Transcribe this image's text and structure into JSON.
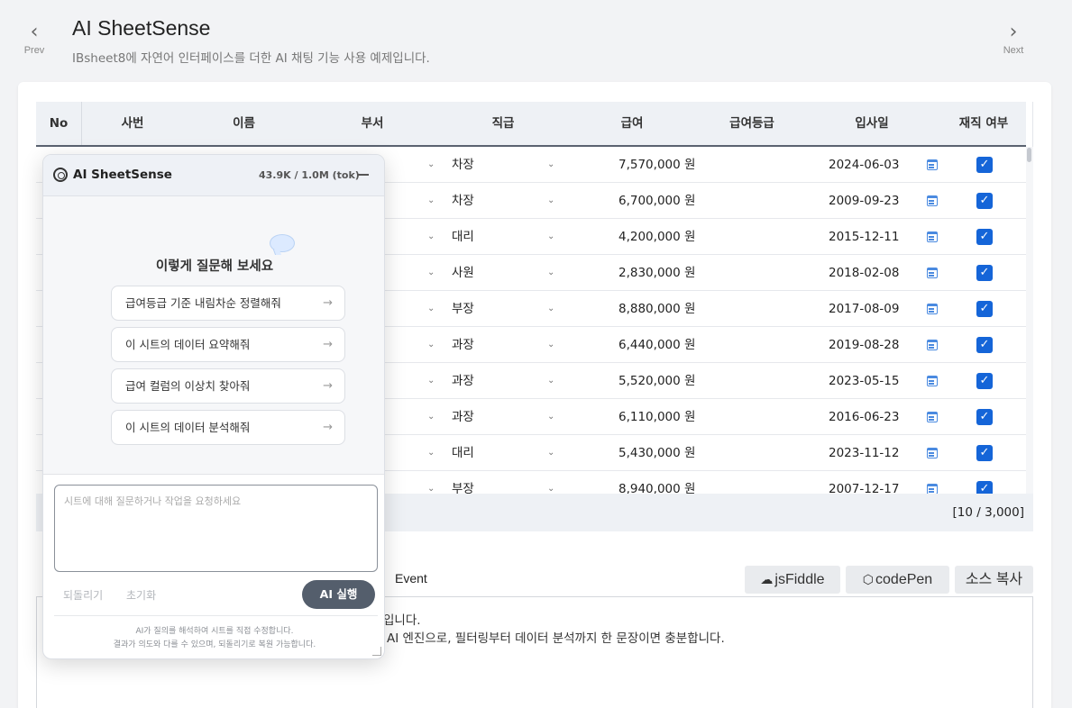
{
  "header": {
    "prev_label": "Prev",
    "next_label": "Next",
    "title": "AI SheetSense",
    "subtitle": "IBsheet8에 자연어 인터페이스를 더한 AI 채팅 기능 사용 예제입니다."
  },
  "grid": {
    "columns": [
      "No",
      "사번",
      "이름",
      "부서",
      "직급",
      "급여",
      "급여등급",
      "입사일",
      "재직 여부"
    ],
    "rows": [
      {
        "rank": "차장",
        "salary": "7,570,000 원",
        "date": "2024-06-03",
        "employed": true
      },
      {
        "rank": "차장",
        "salary": "6,700,000 원",
        "date": "2009-09-23",
        "employed": true
      },
      {
        "rank": "대리",
        "salary": "4,200,000 원",
        "date": "2015-12-11",
        "employed": true
      },
      {
        "rank": "사원",
        "salary": "2,830,000 원",
        "date": "2018-02-08",
        "employed": true
      },
      {
        "rank": "부장",
        "salary": "8,880,000 원",
        "date": "2017-08-09",
        "employed": true
      },
      {
        "rank": "과장",
        "salary": "6,440,000 원",
        "date": "2019-08-28",
        "employed": true
      },
      {
        "rank": "과장",
        "salary": "5,520,000 원",
        "date": "2023-05-15",
        "employed": true
      },
      {
        "rank": "과장",
        "salary": "6,110,000 원",
        "date": "2016-06-23",
        "employed": true
      },
      {
        "rank": "대리",
        "salary": "5,430,000 원",
        "date": "2023-11-12",
        "employed": true
      },
      {
        "rank": "부장",
        "salary": "8,940,000 원",
        "date": "2007-12-17",
        "employed": true
      }
    ],
    "count": "[10 / 3,000]",
    "checkmark": "✓",
    "chevron": "⌄"
  },
  "tabs": {
    "event_label": "Event"
  },
  "tools": {
    "jsfiddle_icon": "☁",
    "jsfiddle_label": "jsFiddle",
    "codepen_icon": "⬡",
    "codepen_label": "codePen",
    "copy_label": "소스 복사"
  },
  "description": {
    "line1": "입니다.",
    "line2": "AI 엔진으로, 필터링부터 데이터 분석까지 한 문장이면 충분합니다."
  },
  "chat": {
    "title": "AI SheetSense",
    "tokens": "43.9K / 1.0M (tok)",
    "prompt": "이렇게 질문해 보세요",
    "suggestions": [
      "급여등급 기준 내림차순 정렬해줘",
      "이 시트의 데이터 요약해줘",
      "급여 컬럼의 이상치 찾아줘",
      "이 시트의 데이터 분석해줘"
    ],
    "arrow": "→",
    "input_placeholder": "시트에 대해 질문하거나 작업을 요청하세요",
    "undo_label": "되돌리기",
    "reset_label": "초기화",
    "run_label": "AI 실행",
    "note_line1": "AI가 질의를 해석하여 시트를 직접 수정합니다.",
    "note_line2": "결과가 의도와 다를 수 있으며, 되돌리기로 복원 가능합니다."
  }
}
